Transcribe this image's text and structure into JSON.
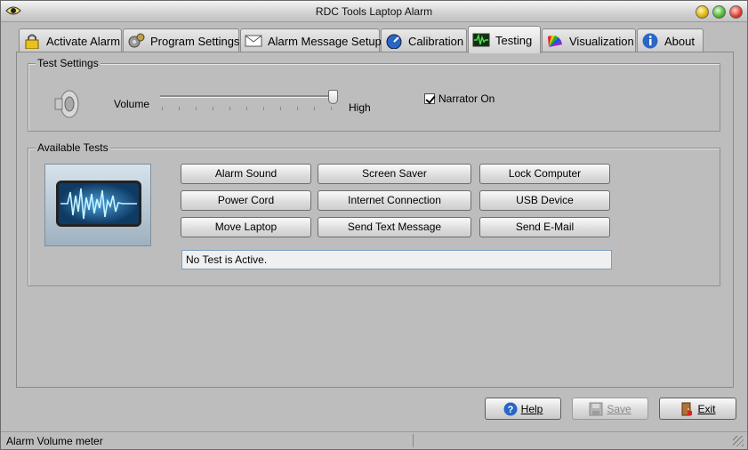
{
  "window": {
    "title": "RDC Tools Laptop Alarm"
  },
  "tabs": [
    {
      "label": "Activate Alarm",
      "icon": "padlock-icon"
    },
    {
      "label": "Program Settings",
      "icon": "gears-icon"
    },
    {
      "label": "Alarm Message Setup",
      "icon": "envelope-icon"
    },
    {
      "label": "Calibration",
      "icon": "gauge-icon"
    },
    {
      "label": "Testing",
      "icon": "waveform-monitor-icon",
      "active": true
    },
    {
      "label": "Visualization",
      "icon": "color-fan-icon"
    },
    {
      "label": "About",
      "icon": "info-icon"
    }
  ],
  "test_settings": {
    "title": "Test Settings",
    "volume_label": "Volume",
    "volume_level": 1.0,
    "high_label": "High",
    "narrator_label": "Narrator On",
    "narrator_checked": true
  },
  "available_tests": {
    "title": "Available Tests",
    "buttons": [
      "Alarm Sound",
      "Screen Saver",
      "Lock Computer",
      "Power Cord",
      "Internet Connection",
      "USB Device",
      "Move Laptop",
      "Send Text Message",
      "Send E-Mail"
    ],
    "status_text": "No Test is Active."
  },
  "footer": {
    "help_label": "Help",
    "save_label": "Save",
    "exit_label": "Exit"
  },
  "statusbar": {
    "text": "Alarm Volume meter"
  },
  "colors": {
    "window_bg": "#bdbdbd",
    "accent_blue": "#2a66c8"
  }
}
